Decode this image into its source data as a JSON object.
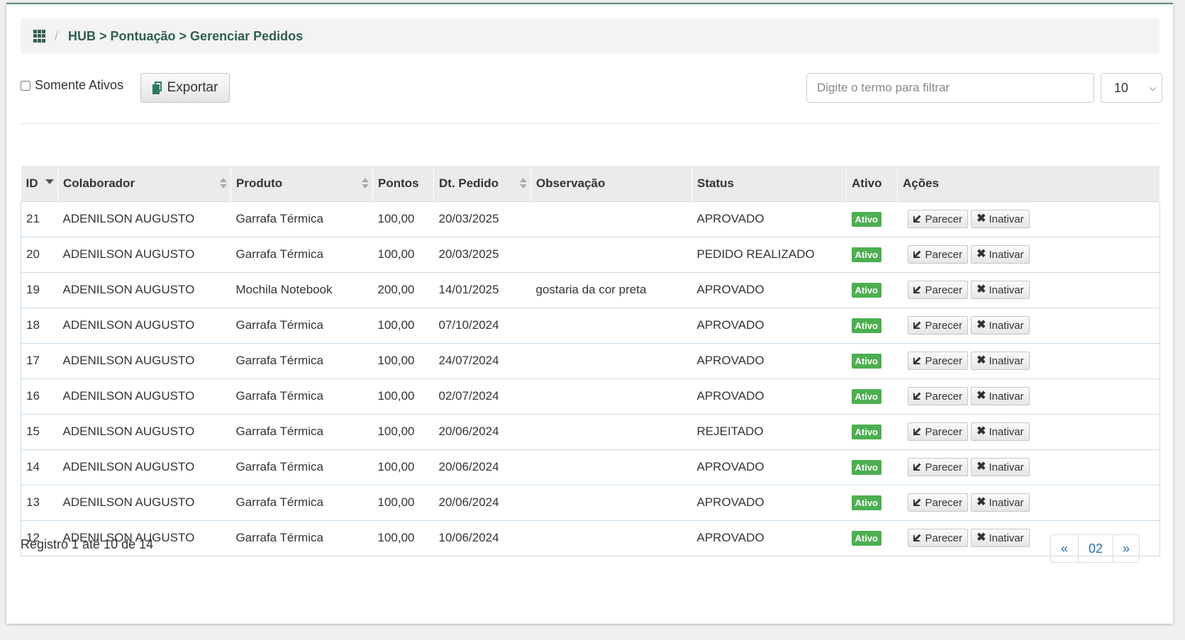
{
  "breadcrumb": {
    "separator": "/",
    "path": "HUB > Pontuação > Gerenciar Pedidos"
  },
  "toolbar": {
    "only_active_label": "Somente Ativos",
    "only_active_checked": false,
    "export_label": "Exportar",
    "filter_placeholder": "Digite o termo para filtrar",
    "filter_value": "",
    "page_size": "10"
  },
  "table": {
    "columns": [
      "ID",
      "Colaborador",
      "Produto",
      "Pontos",
      "Dt. Pedido",
      "Observação",
      "Status",
      "Ativo",
      "Ações"
    ],
    "rows": [
      {
        "id": "21",
        "colaborador": "ADENILSON AUGUSTO",
        "produto": "Garrafa Térmica",
        "pontos": "100,00",
        "data": "20/03/2025",
        "obs": "",
        "status": "APROVADO",
        "ativo": "Ativo"
      },
      {
        "id": "20",
        "colaborador": "ADENILSON AUGUSTO",
        "produto": "Garrafa Térmica",
        "pontos": "100,00",
        "data": "20/03/2025",
        "obs": "",
        "status": "PEDIDO REALIZADO",
        "ativo": "Ativo"
      },
      {
        "id": "19",
        "colaborador": "ADENILSON AUGUSTO",
        "produto": "Mochila Notebook",
        "pontos": "200,00",
        "data": "14/01/2025",
        "obs": "gostaria da cor preta",
        "status": "APROVADO",
        "ativo": "Ativo"
      },
      {
        "id": "18",
        "colaborador": "ADENILSON AUGUSTO",
        "produto": "Garrafa Térmica",
        "pontos": "100,00",
        "data": "07/10/2024",
        "obs": "",
        "status": "APROVADO",
        "ativo": "Ativo"
      },
      {
        "id": "17",
        "colaborador": "ADENILSON AUGUSTO",
        "produto": "Garrafa Térmica",
        "pontos": "100,00",
        "data": "24/07/2024",
        "obs": "",
        "status": "APROVADO",
        "ativo": "Ativo"
      },
      {
        "id": "16",
        "colaborador": "ADENILSON AUGUSTO",
        "produto": "Garrafa Térmica",
        "pontos": "100,00",
        "data": "02/07/2024",
        "obs": "",
        "status": "APROVADO",
        "ativo": "Ativo"
      },
      {
        "id": "15",
        "colaborador": "ADENILSON AUGUSTO",
        "produto": "Garrafa Térmica",
        "pontos": "100,00",
        "data": "20/06/2024",
        "obs": "",
        "status": "REJEITADO",
        "ativo": "Ativo"
      },
      {
        "id": "14",
        "colaborador": "ADENILSON AUGUSTO",
        "produto": "Garrafa Térmica",
        "pontos": "100,00",
        "data": "20/06/2024",
        "obs": "",
        "status": "APROVADO",
        "ativo": "Ativo"
      },
      {
        "id": "13",
        "colaborador": "ADENILSON AUGUSTO",
        "produto": "Garrafa Térmica",
        "pontos": "100,00",
        "data": "20/06/2024",
        "obs": "",
        "status": "APROVADO",
        "ativo": "Ativo"
      },
      {
        "id": "12",
        "colaborador": "ADENILSON AUGUSTO",
        "produto": "Garrafa Térmica",
        "pontos": "100,00",
        "data": "10/06/2024",
        "obs": "",
        "status": "APROVADO",
        "ativo": "Ativo"
      }
    ],
    "actions": {
      "review_label": "Parecer",
      "deactivate_label": "Inativar"
    }
  },
  "footer": {
    "info": "Registro 1 até 10 de 14",
    "pager_prev": "«",
    "pager_page": "02",
    "pager_next": "»"
  },
  "colors": {
    "accent": "#2f5f4d",
    "badge": "#4caf50",
    "link": "#2a6fb0"
  }
}
